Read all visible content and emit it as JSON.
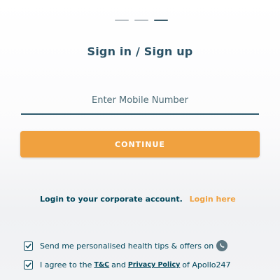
{
  "title": "Sign in / Sign up",
  "mobile": {
    "placeholder": "Enter Mobile Number",
    "value": ""
  },
  "continue_label": "CONTINUE",
  "corporate": {
    "text": "Login to your corporate account.",
    "link_label": "Login here"
  },
  "consents": {
    "tips": {
      "label": "Send me personalised health tips & offers on",
      "checked": true,
      "icon": "whatsapp-icon"
    },
    "terms": {
      "prefix": "I agree to the",
      "tnc_label": "T&C",
      "and": "and",
      "privacy_label": "Privacy Policy",
      "suffix": "of Apollo247",
      "checked": true
    }
  },
  "colors": {
    "accent": "#f0a13f",
    "primary_text": "#02475b"
  }
}
